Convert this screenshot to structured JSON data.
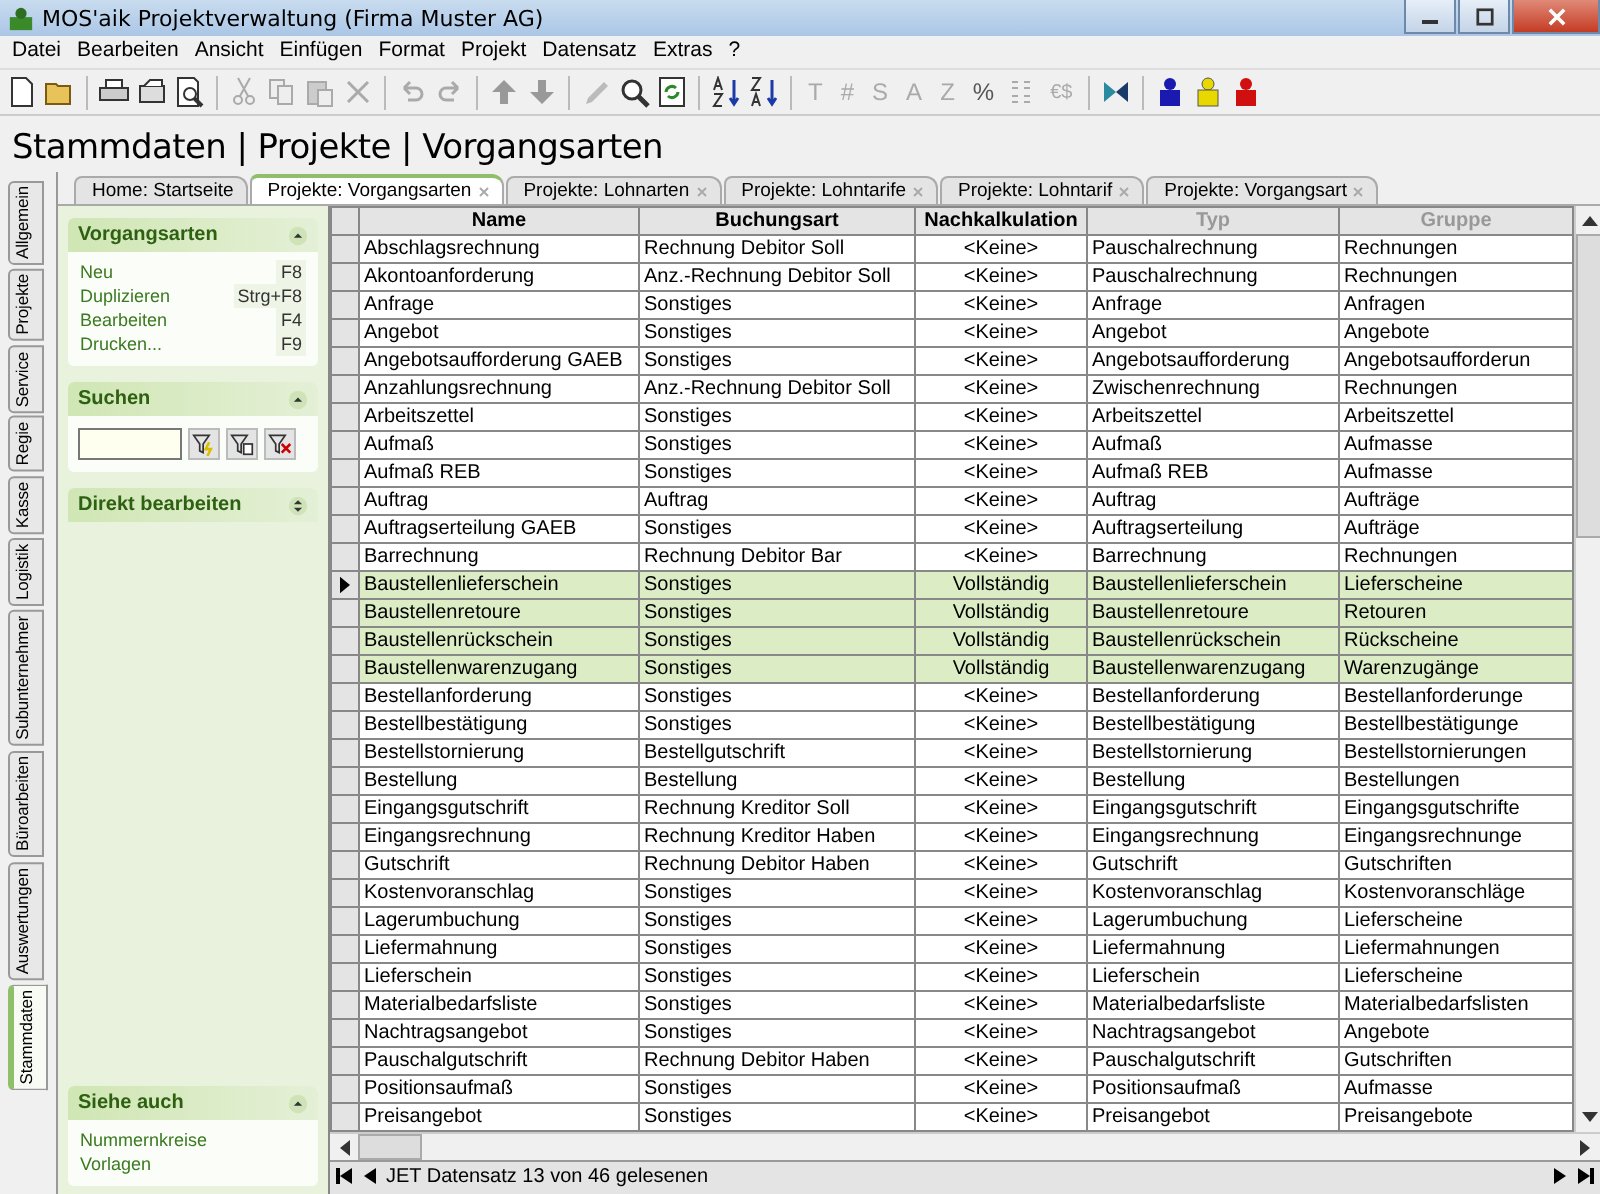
{
  "window": {
    "title": "MOS'aik Projektverwaltung (Firma Muster AG)"
  },
  "menu": [
    "Datei",
    "Bearbeiten",
    "Ansicht",
    "Einfügen",
    "Format",
    "Projekt",
    "Datensatz",
    "Extras",
    "?"
  ],
  "toolbar_text_buttons": [
    {
      "label": "T",
      "disabled": true
    },
    {
      "label": "#",
      "disabled": true
    },
    {
      "label": "S",
      "disabled": true
    },
    {
      "label": "A",
      "disabled": true
    },
    {
      "label": "Z",
      "disabled": true
    },
    {
      "label": "%",
      "disabled": false
    }
  ],
  "toolbar_currency": {
    "label": "€$",
    "disabled": true
  },
  "page_title": "Stammdaten | Projekte | Vorgangsarten",
  "side_tabs": [
    {
      "label": "Allgemein",
      "selected": false
    },
    {
      "label": "Projekte",
      "selected": false
    },
    {
      "label": "Service",
      "selected": false
    },
    {
      "label": "Regie",
      "selected": false
    },
    {
      "label": "Kasse",
      "selected": false
    },
    {
      "label": "Logistik",
      "selected": false
    },
    {
      "label": "Subunternehmer",
      "selected": false
    },
    {
      "label": "Büroarbeiten",
      "selected": false
    },
    {
      "label": "Auswertungen",
      "selected": false
    },
    {
      "label": "Stammdaten",
      "selected": true
    }
  ],
  "doc_tabs": [
    {
      "label": "Home: Startseite",
      "selected": false,
      "closable": false
    },
    {
      "label": "Projekte: Vorgangsarten",
      "selected": true,
      "closable": true
    },
    {
      "label": "Projekte: Lohnarten",
      "selected": false,
      "closable": true
    },
    {
      "label": "Projekte: Lohntarife",
      "selected": false,
      "closable": true
    },
    {
      "label": "Projekte: Lohntarif",
      "selected": false,
      "closable": true
    },
    {
      "label": "Projekte: Vorgangsart",
      "selected": false,
      "closable": true
    }
  ],
  "panel": {
    "sections": [
      {
        "kind": "actions",
        "title": "Vorgangsarten",
        "expanded": true,
        "items": [
          {
            "label": "Neu",
            "shortcut": "F8"
          },
          {
            "label": "Duplizieren",
            "shortcut": "Strg+F8"
          },
          {
            "label": "Bearbeiten",
            "shortcut": "F4"
          },
          {
            "label": "Drucken...",
            "shortcut": "F9"
          }
        ]
      },
      {
        "kind": "search",
        "title": "Suchen",
        "expanded": true
      },
      {
        "kind": "actions",
        "title": "Direkt bearbeiten",
        "expanded": false
      }
    ],
    "footer_section": {
      "title": "Siehe auch",
      "expanded": true,
      "links": [
        "Nummernkreise",
        "Vorlagen"
      ]
    }
  },
  "table": {
    "columns": [
      {
        "label": "Name",
        "disabled": false
      },
      {
        "label": "Buchungsart",
        "disabled": false
      },
      {
        "label": "Nachkalkulation",
        "disabled": false
      },
      {
        "label": "Typ",
        "disabled": true
      },
      {
        "label": "Gruppe",
        "disabled": true
      }
    ],
    "rows": [
      {
        "cells": [
          "Abschlagsrechnung",
          "Rechnung Debitor Soll",
          "<Keine>",
          "Pauschalrechnung",
          "Rechnungen"
        ],
        "selected": false,
        "current": false
      },
      {
        "cells": [
          "Akontoanforderung",
          "Anz.-Rechnung Debitor Soll",
          "<Keine>",
          "Pauschalrechnung",
          "Rechnungen"
        ],
        "selected": false,
        "current": false
      },
      {
        "cells": [
          "Anfrage",
          "Sonstiges",
          "<Keine>",
          "Anfrage",
          "Anfragen"
        ],
        "selected": false,
        "current": false
      },
      {
        "cells": [
          "Angebot",
          "Sonstiges",
          "<Keine>",
          "Angebot",
          "Angebote"
        ],
        "selected": false,
        "current": false
      },
      {
        "cells": [
          "Angebotsaufforderung GAEB",
          "Sonstiges",
          "<Keine>",
          "Angebotsaufforderung",
          "Angebotsaufforderun"
        ],
        "selected": false,
        "current": false
      },
      {
        "cells": [
          "Anzahlungsrechnung",
          "Anz.-Rechnung Debitor Soll",
          "<Keine>",
          "Zwischenrechnung",
          "Rechnungen"
        ],
        "selected": false,
        "current": false
      },
      {
        "cells": [
          "Arbeitszettel",
          "Sonstiges",
          "<Keine>",
          "Arbeitszettel",
          "Arbeitszettel"
        ],
        "selected": false,
        "current": false
      },
      {
        "cells": [
          "Aufmaß",
          "Sonstiges",
          "<Keine>",
          "Aufmaß",
          "Aufmasse"
        ],
        "selected": false,
        "current": false
      },
      {
        "cells": [
          "Aufmaß REB",
          "Sonstiges",
          "<Keine>",
          "Aufmaß REB",
          "Aufmasse"
        ],
        "selected": false,
        "current": false
      },
      {
        "cells": [
          "Auftrag",
          "Auftrag",
          "<Keine>",
          "Auftrag",
          "Aufträge"
        ],
        "selected": false,
        "current": false
      },
      {
        "cells": [
          "Auftragserteilung GAEB",
          "Sonstiges",
          "<Keine>",
          "Auftragserteilung",
          "Aufträge"
        ],
        "selected": false,
        "current": false
      },
      {
        "cells": [
          "Barrechnung",
          "Rechnung Debitor Bar",
          "<Keine>",
          "Barrechnung",
          "Rechnungen"
        ],
        "selected": false,
        "current": false
      },
      {
        "cells": [
          "Baustellenlieferschein",
          "Sonstiges",
          "Vollständig",
          "Baustellenlieferschein",
          "Lieferscheine"
        ],
        "selected": true,
        "current": true
      },
      {
        "cells": [
          "Baustellenretoure",
          "Sonstiges",
          "Vollständig",
          "Baustellenretoure",
          "Retouren"
        ],
        "selected": true,
        "current": false
      },
      {
        "cells": [
          "Baustellenrückschein",
          "Sonstiges",
          "Vollständig",
          "Baustellenrückschein",
          "Rückscheine"
        ],
        "selected": true,
        "current": false
      },
      {
        "cells": [
          "Baustellenwarenzugang",
          "Sonstiges",
          "Vollständig",
          "Baustellenwarenzugang",
          "Warenzugänge"
        ],
        "selected": true,
        "current": false
      },
      {
        "cells": [
          "Bestellanforderung",
          "Sonstiges",
          "<Keine>",
          "Bestellanforderung",
          "Bestellanforderunge"
        ],
        "selected": false,
        "current": false
      },
      {
        "cells": [
          "Bestellbestätigung",
          "Sonstiges",
          "<Keine>",
          "Bestellbestätigung",
          "Bestellbestätigunge"
        ],
        "selected": false,
        "current": false
      },
      {
        "cells": [
          "Bestellstornierung",
          "Bestellgutschrift",
          "<Keine>",
          "Bestellstornierung",
          "Bestellstornierungen"
        ],
        "selected": false,
        "current": false
      },
      {
        "cells": [
          "Bestellung",
          "Bestellung",
          "<Keine>",
          "Bestellung",
          "Bestellungen"
        ],
        "selected": false,
        "current": false
      },
      {
        "cells": [
          "Eingangsgutschrift",
          "Rechnung Kreditor Soll",
          "<Keine>",
          "Eingangsgutschrift",
          "Eingangsgutschrifte"
        ],
        "selected": false,
        "current": false
      },
      {
        "cells": [
          "Eingangsrechnung",
          "Rechnung Kreditor Haben",
          "<Keine>",
          "Eingangsrechnung",
          "Eingangsrechnunge"
        ],
        "selected": false,
        "current": false
      },
      {
        "cells": [
          "Gutschrift",
          "Rechnung Debitor Haben",
          "<Keine>",
          "Gutschrift",
          "Gutschriften"
        ],
        "selected": false,
        "current": false
      },
      {
        "cells": [
          "Kostenvoranschlag",
          "Sonstiges",
          "<Keine>",
          "Kostenvoranschlag",
          "Kostenvoranschläge"
        ],
        "selected": false,
        "current": false
      },
      {
        "cells": [
          "Lagerumbuchung",
          "Sonstiges",
          "<Keine>",
          "Lagerumbuchung",
          "Lieferscheine"
        ],
        "selected": false,
        "current": false
      },
      {
        "cells": [
          "Liefermahnung",
          "Sonstiges",
          "<Keine>",
          "Liefermahnung",
          "Liefermahnungen"
        ],
        "selected": false,
        "current": false
      },
      {
        "cells": [
          "Lieferschein",
          "Sonstiges",
          "<Keine>",
          "Lieferschein",
          "Lieferscheine"
        ],
        "selected": false,
        "current": false
      },
      {
        "cells": [
          "Materialbedarfsliste",
          "Sonstiges",
          "<Keine>",
          "Materialbedarfsliste",
          "Materialbedarfslisten"
        ],
        "selected": false,
        "current": false
      },
      {
        "cells": [
          "Nachtragsangebot",
          "Sonstiges",
          "<Keine>",
          "Nachtragsangebot",
          "Angebote"
        ],
        "selected": false,
        "current": false
      },
      {
        "cells": [
          "Pauschalgutschrift",
          "Rechnung Debitor Haben",
          "<Keine>",
          "Pauschalgutschrift",
          "Gutschriften"
        ],
        "selected": false,
        "current": false
      },
      {
        "cells": [
          "Positionsaufmaß",
          "Sonstiges",
          "<Keine>",
          "Positionsaufmaß",
          "Aufmasse"
        ],
        "selected": false,
        "current": false
      },
      {
        "cells": [
          "Preisangebot",
          "Sonstiges",
          "<Keine>",
          "Preisangebot",
          "Preisangebote"
        ],
        "selected": false,
        "current": false
      }
    ]
  },
  "status_bar": {
    "text": "JET Datensatz 13 von 46 gelesenen"
  }
}
